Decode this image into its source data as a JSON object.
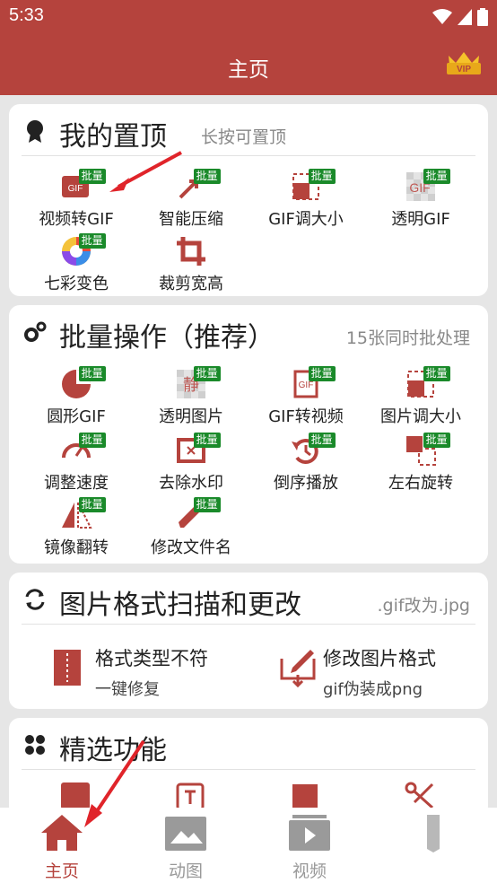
{
  "status": {
    "time": "5:33"
  },
  "header": {
    "title": "主页",
    "vip": "VIP"
  },
  "badge": "批量",
  "pinned": {
    "title": "我的置顶",
    "subtitle": "长按可置顶",
    "items": [
      {
        "label": "视频转GIF",
        "icon": "video-to-gif-icon"
      },
      {
        "label": "智能压缩",
        "icon": "compress-icon"
      },
      {
        "label": "GIF调大小",
        "icon": "resize-icon"
      },
      {
        "label": "透明GIF",
        "icon": "transparent-gif-icon"
      },
      {
        "label": "七彩变色",
        "icon": "color-wheel-icon"
      },
      {
        "label": "裁剪宽高",
        "icon": "crop-icon"
      }
    ]
  },
  "batch": {
    "title": "批量操作（推荐）",
    "subtitle": "15张同时批处理",
    "items": [
      {
        "label": "圆形GIF",
        "icon": "circle-gif-icon"
      },
      {
        "label": "透明图片",
        "icon": "transparent-image-icon"
      },
      {
        "label": "GIF转视频",
        "icon": "gif-to-video-icon"
      },
      {
        "label": "图片调大小",
        "icon": "image-resize-icon"
      },
      {
        "label": "调整速度",
        "icon": "speed-icon"
      },
      {
        "label": "去除水印",
        "icon": "watermark-remove-icon"
      },
      {
        "label": "倒序播放",
        "icon": "reverse-play-icon"
      },
      {
        "label": "左右旋转",
        "icon": "rotate-icon"
      },
      {
        "label": "镜像翻转",
        "icon": "mirror-icon"
      },
      {
        "label": "修改文件名",
        "icon": "rename-icon"
      }
    ]
  },
  "format": {
    "title": "图片格式扫描和更改",
    "subtitle": ".gif改为.jpg",
    "left": {
      "title": "格式类型不符",
      "sub": "一键修复"
    },
    "right": {
      "title": "修改图片格式",
      "sub": "gif伪装成png"
    }
  },
  "featured": {
    "title": "精选功能"
  },
  "nav": [
    {
      "label": "主页",
      "icon": "home-icon"
    },
    {
      "label": "动图",
      "icon": "gif-gallery-icon"
    },
    {
      "label": "视频",
      "icon": "video-icon"
    },
    {
      "label": "",
      "icon": "user-icon"
    }
  ],
  "colors": {
    "primary": "#b5433d",
    "badge": "#1a8a2a",
    "arrow": "#e0242a"
  }
}
